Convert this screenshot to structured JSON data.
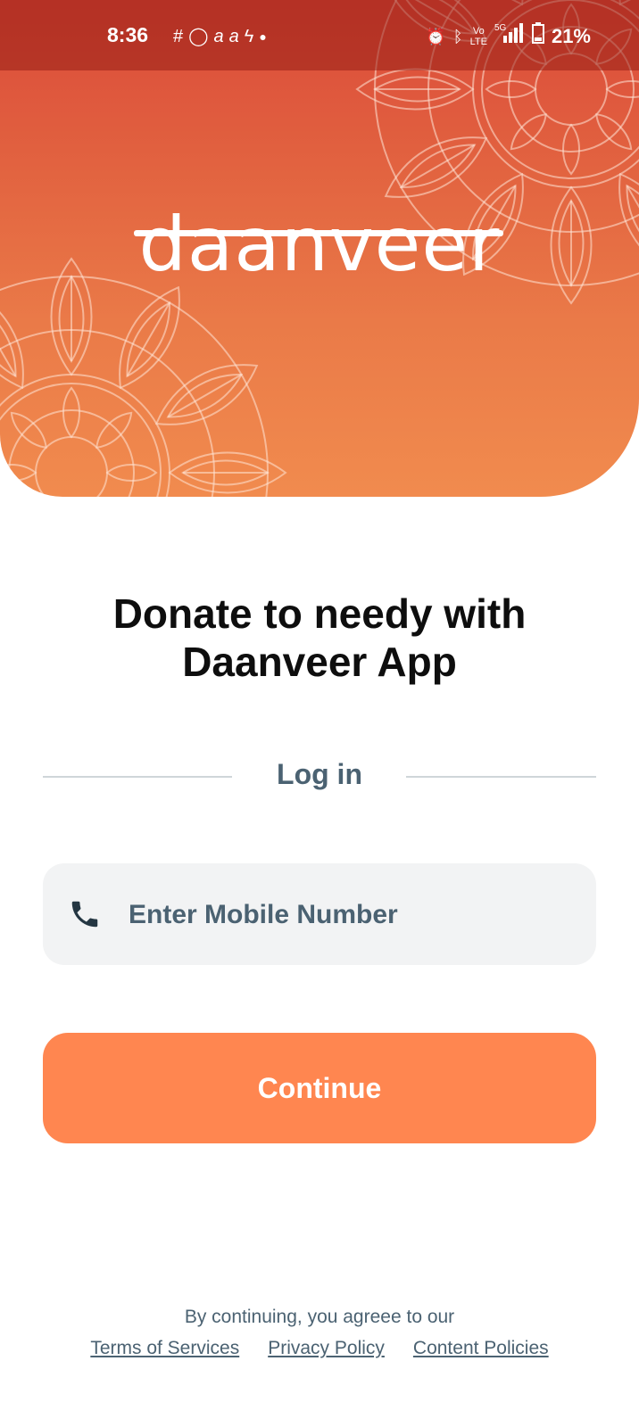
{
  "status_bar": {
    "time": "8:36",
    "battery": "21%",
    "notif_icons": [
      "slack-icon",
      "whatsapp-icon",
      "a-icon",
      "a-icon",
      "figure-icon",
      "dot-icon"
    ],
    "sys_icons": [
      "alarm-icon",
      "bluetooth-icon",
      "volte-icon",
      "5g-signal-icon",
      "battery-icon"
    ]
  },
  "header": {
    "logo": "daanveer",
    "gradient_top": "#db4a3a",
    "gradient_bottom": "#f18b4e"
  },
  "headline": {
    "line1": "Donate to needy with",
    "line2": "Daanveer App"
  },
  "login": {
    "label": "Log in",
    "phone_placeholder": "Enter Mobile Number",
    "continue_label": "Continue",
    "button_color": "#ff8650"
  },
  "footer": {
    "text": "By continuing, you agreee to our",
    "links": [
      "Terms of Services",
      "Privacy Policy",
      "Content Policies"
    ]
  },
  "colors": {
    "text_dark": "#0e0e0e",
    "text_muted": "#4b6272",
    "field_bg": "#f2f3f4"
  }
}
